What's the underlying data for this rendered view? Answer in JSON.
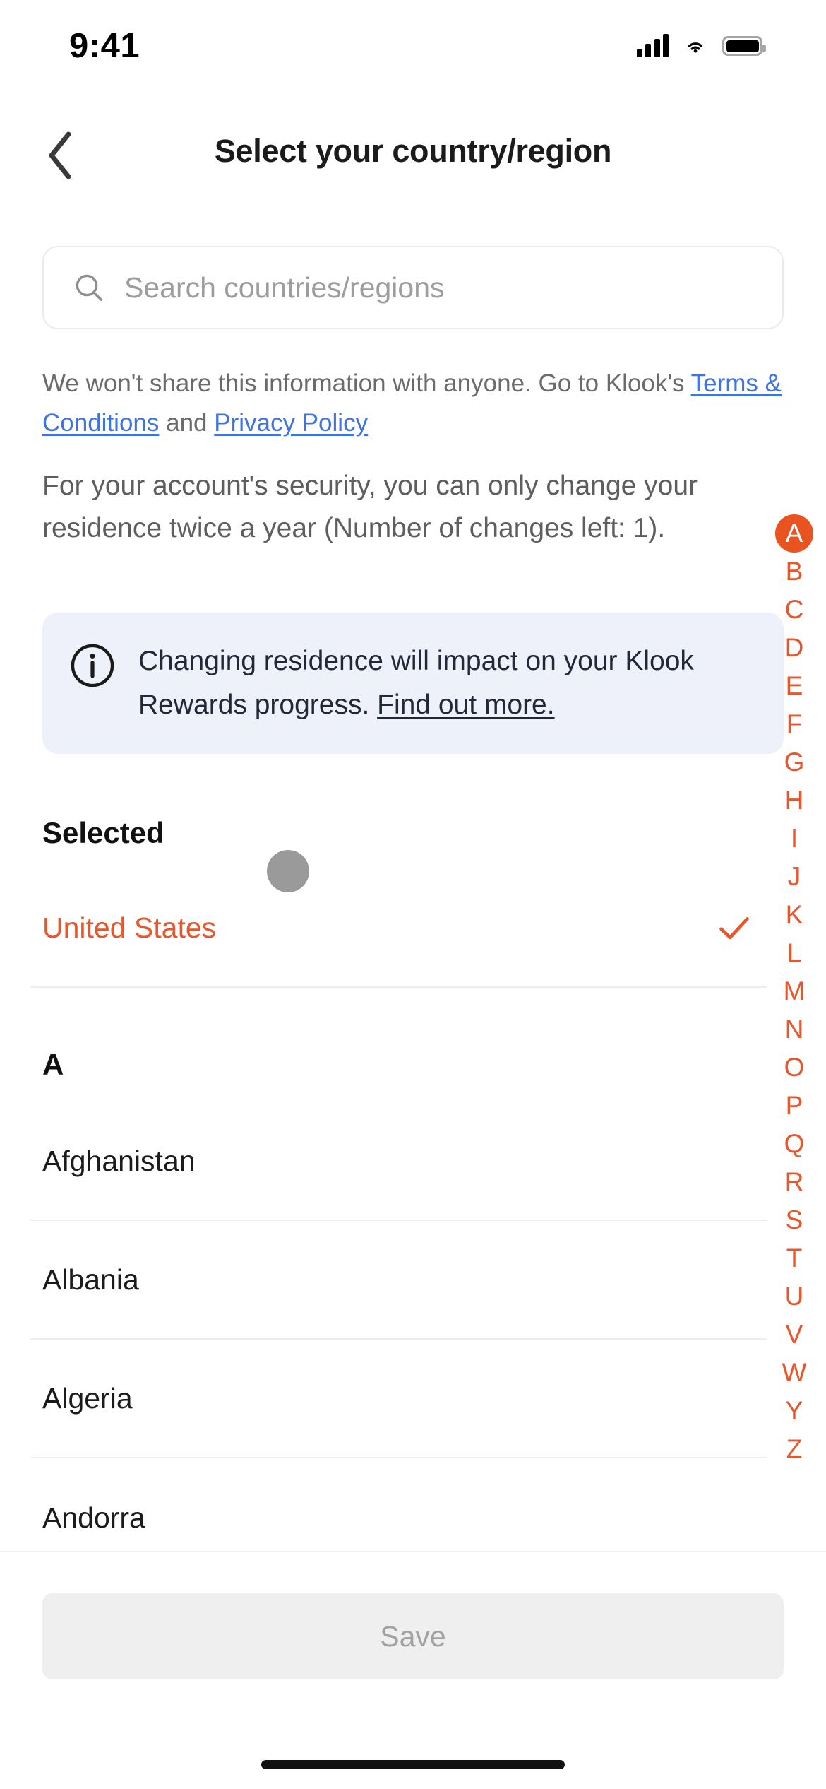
{
  "status_bar": {
    "time": "9:41",
    "cellular_icon": "cellular-signal-icon",
    "wifi_icon": "wifi-icon",
    "battery_icon": "battery-full-icon"
  },
  "nav": {
    "back_icon": "chevron-left-icon",
    "title": "Select your country/region"
  },
  "search": {
    "icon": "search-icon",
    "placeholder": "Search countries/regions",
    "value": ""
  },
  "disclaimer": {
    "prefix": "We won't share this information with anyone. Go to Klook's ",
    "terms_link": "Terms & Conditions",
    "middle": " and ",
    "privacy_link": "Privacy Policy",
    "link_color": "#3f74e0"
  },
  "security_note": "For your account's security, you can only change your residence twice a year (Number of changes left: 1).",
  "info_banner": {
    "icon": "info-circle-icon",
    "text": "Changing residence will impact on your Klook Rewards progress. ",
    "link": "Find out more.",
    "background_color": "#eef0fa",
    "text_color": "#232838"
  },
  "selected_section": {
    "header": "Selected",
    "country": "United States",
    "check_icon": "checkmark-icon",
    "accent_color": "#e8562b"
  },
  "cursor": {
    "name": "touch-indicator",
    "color": "#9a9a9a"
  },
  "list": {
    "section_letter": "A",
    "countries": [
      "Afghanistan",
      "Albania",
      "Algeria",
      "Andorra"
    ]
  },
  "alpha_index": {
    "active": "A",
    "letters": [
      "A",
      "B",
      "C",
      "D",
      "E",
      "F",
      "G",
      "H",
      "I",
      "J",
      "K",
      "L",
      "M",
      "N",
      "O",
      "P",
      "Q",
      "R",
      "S",
      "T",
      "U",
      "V",
      "W",
      "Y",
      "Z"
    ],
    "color": "#e8562b",
    "active_bg": "#e8531f"
  },
  "footer": {
    "save_label": "Save",
    "save_enabled": false
  }
}
